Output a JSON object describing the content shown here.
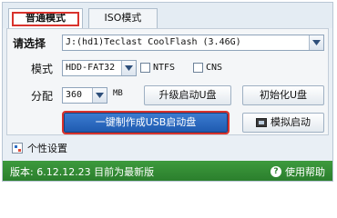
{
  "tabs": [
    {
      "label": "普通模式",
      "active": true
    },
    {
      "label": "ISO模式",
      "active": false
    }
  ],
  "form": {
    "select_label": "请选择",
    "drive_value": "J:(hd1)Teclast CoolFlash (3.46G)",
    "mode_label": "模式",
    "mode_value": "HDD-FAT32",
    "ntfs_label": "NTFS",
    "cns_label": "CNS",
    "alloc_label": "分配",
    "alloc_value": "360",
    "alloc_unit": "MB",
    "upgrade_button": "升级启动U盘",
    "init_button": "初始化U盘",
    "make_button": "一键制作成USB启动盘",
    "simulate_button": "模拟启动"
  },
  "custom_settings_label": "个性设置",
  "status": {
    "version_text": "版本: 6.12.12.23 目前为最新版",
    "help_label": "使用帮助"
  },
  "colors": {
    "accent_red": "#d8322c",
    "primary_blue": "#1f5bb0",
    "status_green": "#2b7f2d"
  },
  "icons": [
    "chevron-down-icon",
    "monitor-icon",
    "settings-icon",
    "help-icon"
  ]
}
